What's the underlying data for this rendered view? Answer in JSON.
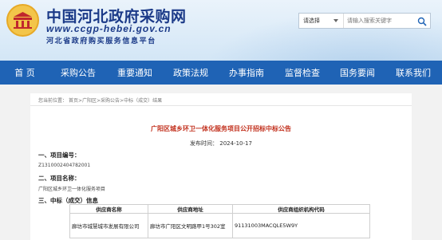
{
  "header": {
    "site_title": "中国河北政府采购网",
    "site_url": "www.ccgp-hebei.gov.cn",
    "site_subtitle": "河北省政府购买服务信息平台",
    "logo_icon": "ccgp-emblem-icon"
  },
  "search": {
    "scope_label": "请选择",
    "placeholder": "请输入搜索关键字",
    "button_icon": "search-icon"
  },
  "nav": {
    "items": [
      "首 页",
      "采购公告",
      "重要通知",
      "政策法规",
      "办事指南",
      "监督检查",
      "国务要闻",
      "联系我们"
    ]
  },
  "breadcrumb": {
    "prefix": "您当前位置：",
    "path": [
      "首页",
      "广阳区",
      "采购公告",
      "中标（成交）结果"
    ],
    "separator": ">"
  },
  "article": {
    "title": "广阳区城乡环卫一体化服务项目公开招标中标公告",
    "publish_label": "发布时间：",
    "publish_date": "2024-10-17",
    "section1": {
      "heading": "一、项目编号：",
      "value": "Z131000240478200​1"
    },
    "section2": {
      "heading": "二、项目名称：",
      "value": "广阳区城乡环卫一体化服务项目"
    },
    "section3": {
      "heading": "三、中标（成交）信息"
    }
  },
  "supplier_table": {
    "headers": [
      "供应商名称",
      "供应商地址",
      "供应商组织机构代码"
    ],
    "rows": [
      [
        "廊坊市城慧城市发展有限公司",
        "廊坊市广阳区文明路甲1号302室",
        "91131003MACQLE5W9Y"
      ]
    ]
  }
}
